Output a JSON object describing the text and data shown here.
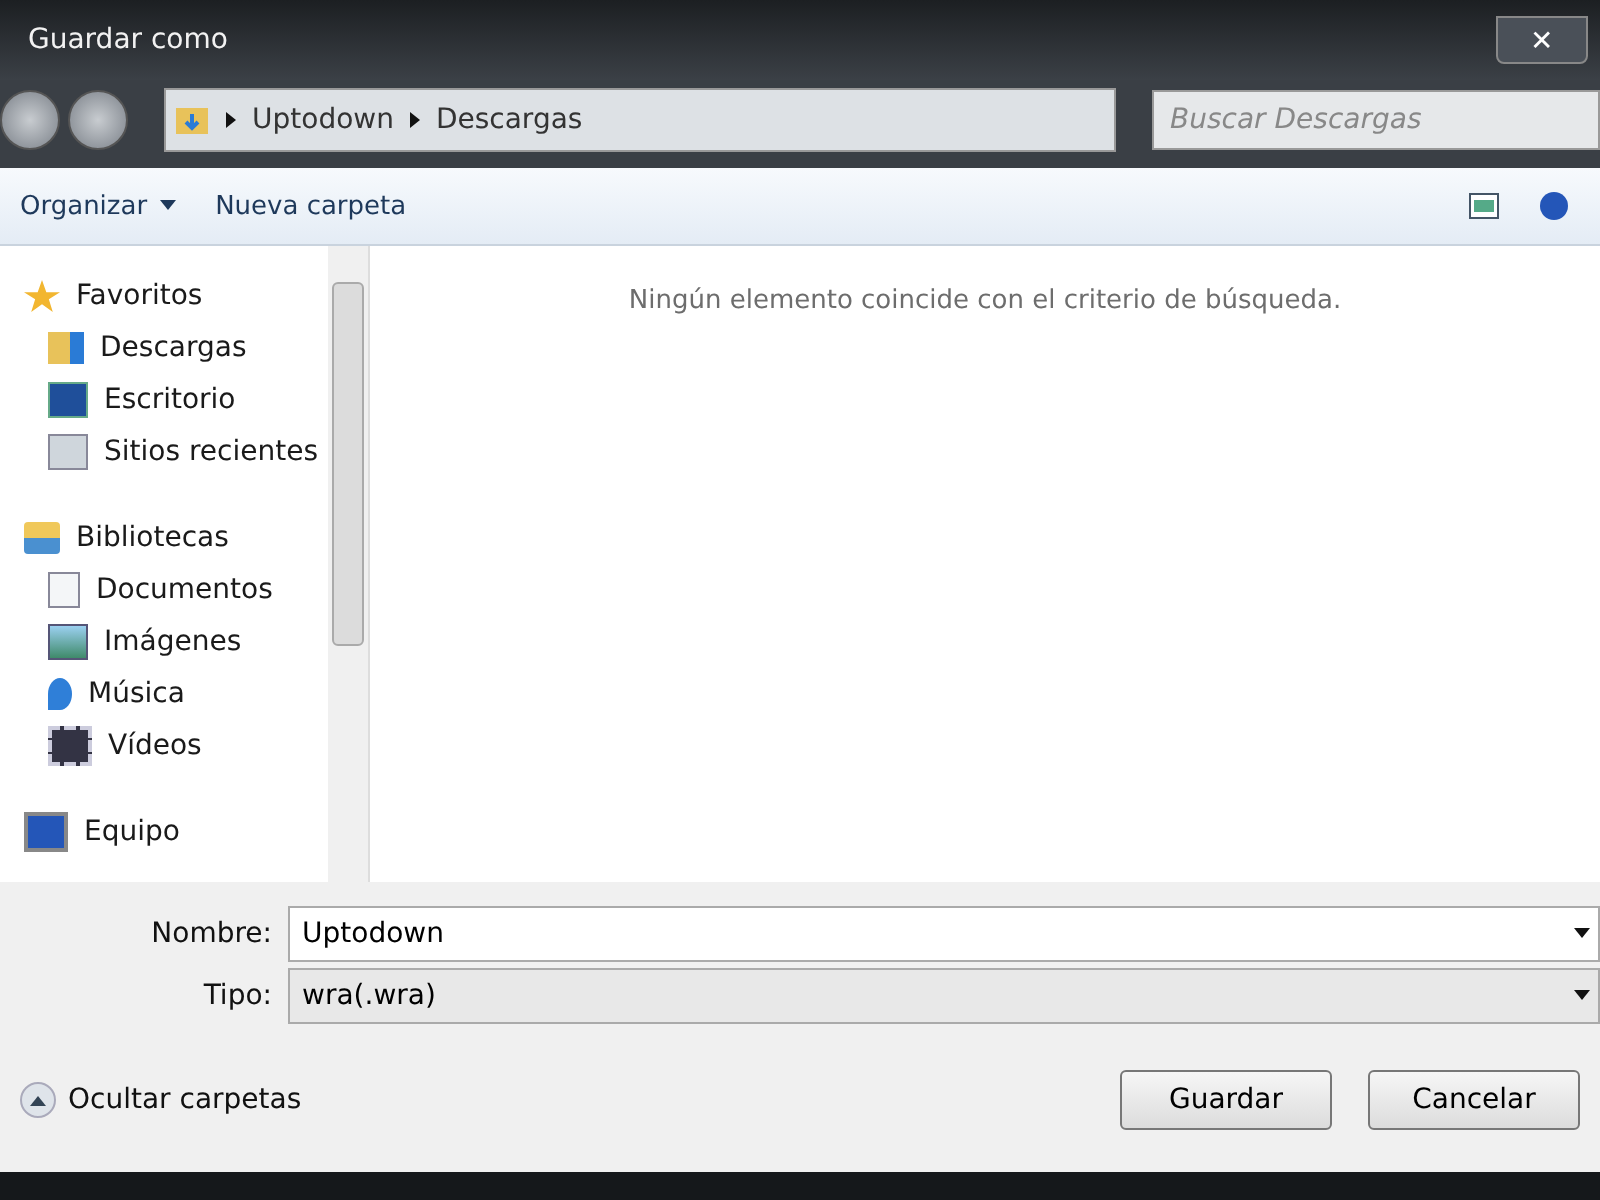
{
  "window": {
    "title": "Guardar como",
    "close": "✕"
  },
  "address": {
    "crumbs": [
      "Uptodown",
      "Descargas"
    ]
  },
  "search": {
    "placeholder": "Buscar Descargas"
  },
  "toolbar": {
    "organize": "Organizar",
    "new_folder": "Nueva carpeta"
  },
  "sidebar": {
    "items": [
      {
        "label": "Favoritos",
        "children": [
          {
            "label": "Descargas"
          },
          {
            "label": "Escritorio"
          },
          {
            "label": "Sitios recientes"
          }
        ]
      },
      {
        "label": "Bibliotecas",
        "children": [
          {
            "label": "Documentos"
          },
          {
            "label": "Imágenes"
          },
          {
            "label": "Música"
          },
          {
            "label": "Vídeos"
          }
        ]
      },
      {
        "label": "Equipo"
      }
    ]
  },
  "content": {
    "empty_message": "Ningún elemento coincide con el criterio de búsqueda."
  },
  "form": {
    "name_label": "Nombre:",
    "name_value": "Uptodown",
    "type_label": "Tipo:",
    "type_value": "wra(.wra)"
  },
  "hide_folders": "Ocultar carpetas",
  "buttons": [
    "Guardar",
    "Cancelar"
  ]
}
